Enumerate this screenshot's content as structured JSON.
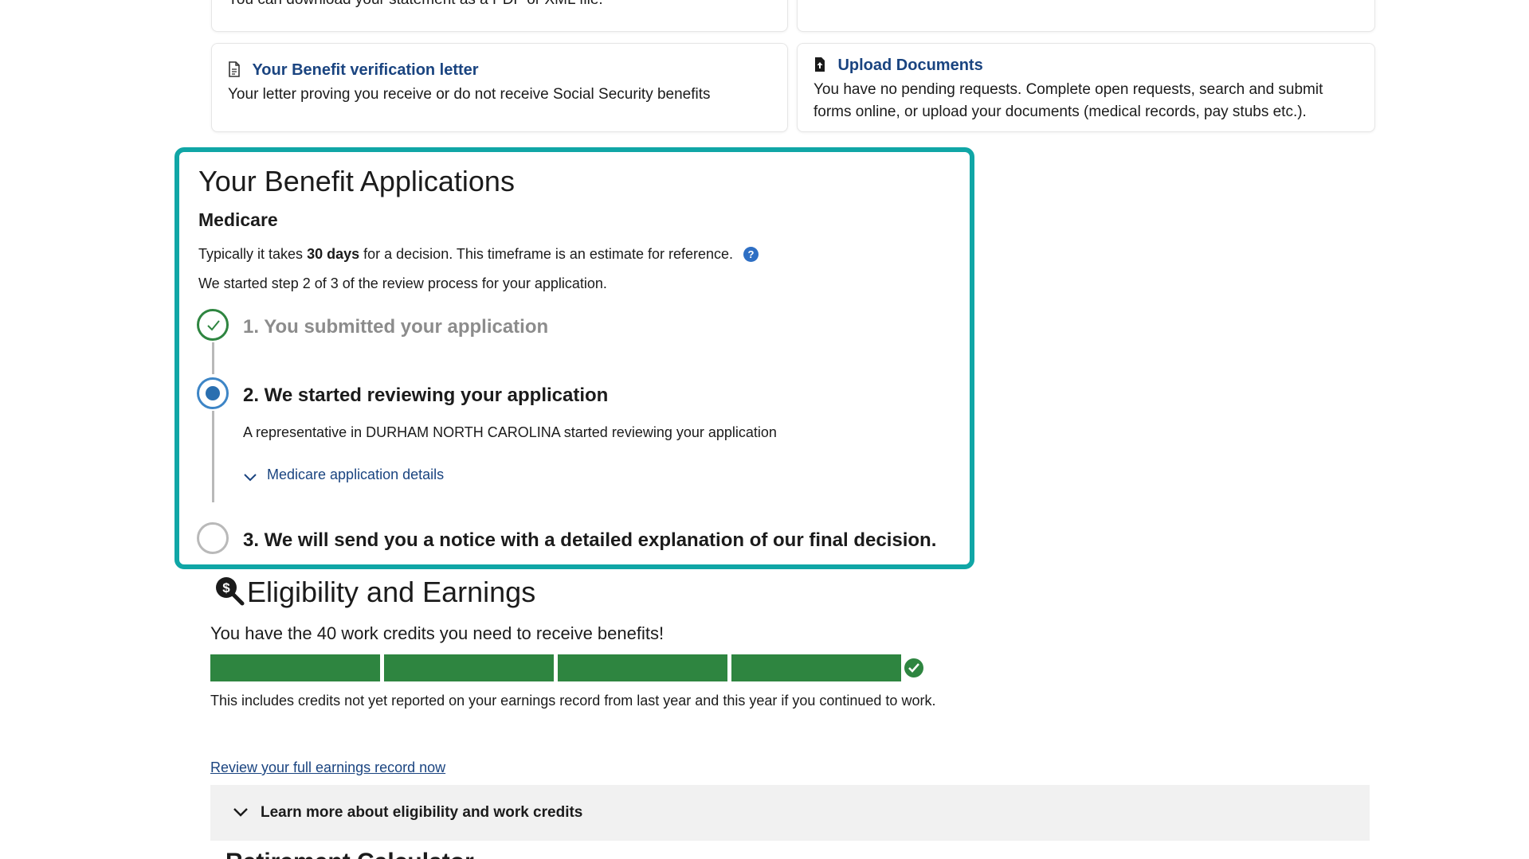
{
  "top_cards": {
    "statement_note": "You can download your statement as a PDF or XML file.",
    "verification": {
      "title": "Your Benefit verification letter",
      "desc": "Your letter proving you receive or do not receive Social Security benefits"
    },
    "upload": {
      "title": "Upload Documents",
      "desc_line1": "You have no pending requests. Complete open requests, search and submit",
      "desc_line2": "forms online, or upload your documents (medical records, pay stubs etc.)."
    }
  },
  "applications": {
    "title": "Your Benefit Applications",
    "program": "Medicare",
    "timeframe_pre": "Typically it takes",
    "timeframe_bold": "30 days",
    "timeframe_post": "for a decision. This timeframe is an estimate for reference.",
    "progress_text": "We started step 2 of 3 of the review process for your application.",
    "steps": [
      {
        "label": "1. You submitted your application",
        "state": "done"
      },
      {
        "label": "2. We started reviewing your application",
        "state": "active",
        "note": "A representative in DURHAM NORTH CAROLINA started reviewing your application",
        "link": "Medicare application details"
      },
      {
        "label": "3. We will send you a notice with a detailed explanation of our final decision.",
        "state": "todo"
      }
    ]
  },
  "eligibility": {
    "title": "Eligibility and Earnings",
    "credits_text": "You have the 40 work credits you need to receive benefits!",
    "credits_earned": 40,
    "credits_needed": 40,
    "credits_note": "This includes credits not yet reported on your earnings record from last year and this year if you continued to work.",
    "review_link": "Review your full earnings record now",
    "accordion_label": "Learn more about eligibility and work credits"
  },
  "next_section_partial": "Retirement Calculator",
  "colors": {
    "highlight": "#10a6a6",
    "success": "#2e8540",
    "link": "#1a4480",
    "active_step": "#2a6fb0"
  }
}
